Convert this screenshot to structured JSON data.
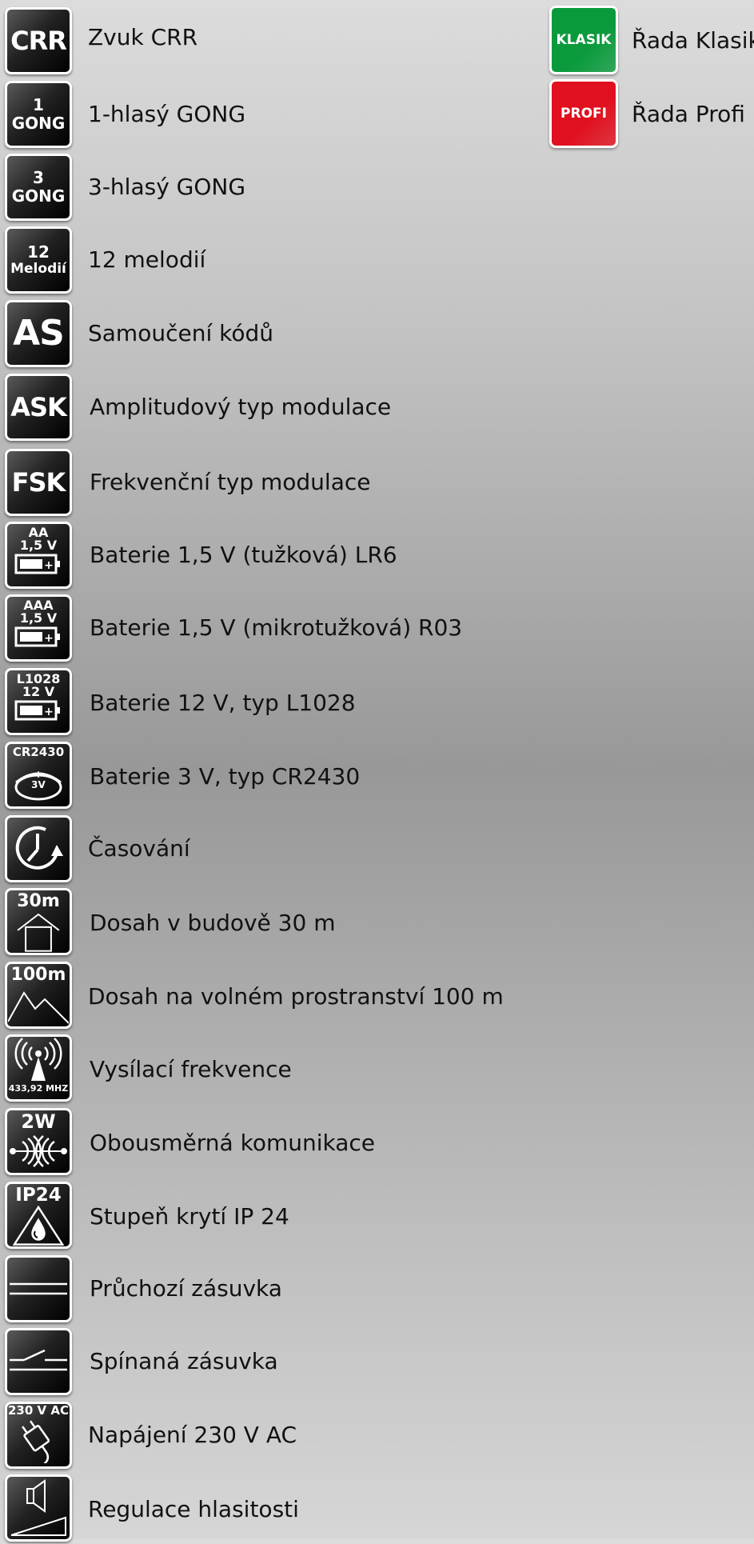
{
  "legend": [
    {
      "badge": [
        "CRR"
      ],
      "label": "Zvuk CRR"
    },
    {
      "badge": [
        "1",
        "GONG"
      ],
      "label": "1-hlasý GONG"
    },
    {
      "badge": [
        "3",
        "GONG"
      ],
      "label": "3-hlasý GONG"
    },
    {
      "badge": [
        "12",
        "Melodií"
      ],
      "label": "12 melodií"
    },
    {
      "badge": [
        "AS"
      ],
      "label": "Samoučení kódů"
    },
    {
      "badge": [
        "ASK"
      ],
      "label": "Amplitudový typ modulace"
    },
    {
      "badge": [
        "FSK"
      ],
      "label": "Frekvenční typ modulace"
    },
    {
      "badge": [
        "AA",
        "1,5 V"
      ],
      "icon": "battery-icon",
      "label": "Baterie 1,5 V (tužková) LR6"
    },
    {
      "badge": [
        "AAA",
        "1,5 V"
      ],
      "icon": "battery-icon",
      "label": "Baterie 1,5 V (mikrotužková) R03"
    },
    {
      "badge": [
        "L1028",
        "12 V"
      ],
      "icon": "battery-icon",
      "label": "Baterie 12 V, typ L1028"
    },
    {
      "badge": [
        "CR2430",
        "+",
        "3V"
      ],
      "icon": "coin-cell-icon",
      "label": "Baterie 3 V, typ CR2430"
    },
    {
      "icon": "timer-icon",
      "label": "Časování"
    },
    {
      "badge": [
        "30m"
      ],
      "icon": "house-icon",
      "label": "Dosah v budově 30 m"
    },
    {
      "badge": [
        "100m"
      ],
      "icon": "mountain-icon",
      "label": "Dosah na volném prostranství 100 m"
    },
    {
      "badge": [
        "433,92 MHZ"
      ],
      "icon": "antenna-icon",
      "label": "Vysílací frekvence"
    },
    {
      "badge": [
        "2W"
      ],
      "icon": "two-way-icon",
      "label": "Obousměrná komunikace"
    },
    {
      "badge": [
        "IP24"
      ],
      "icon": "water-drop-icon",
      "label": "Stupeň krytí IP 24"
    },
    {
      "icon": "pass-through-socket-icon",
      "label": "Průchozí zásuvka"
    },
    {
      "icon": "switched-socket-icon",
      "label": "Spínaná zásuvka"
    },
    {
      "badge": [
        "230 V AC"
      ],
      "icon": "plug-icon",
      "label": "Napájení 230 V AC"
    },
    {
      "icon": "speaker-volume-icon",
      "label": "Regulace hlasitosti"
    }
  ],
  "series": [
    {
      "badge": "KLASIK",
      "label": "Řada Klasik",
      "color": "#0a9a3c"
    },
    {
      "badge": "PROFI",
      "label": "Řada Profi",
      "color": "#e0101e"
    }
  ]
}
